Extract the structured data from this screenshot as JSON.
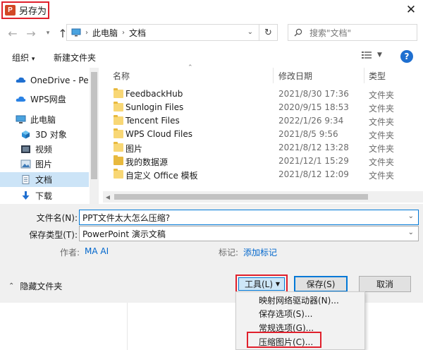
{
  "window": {
    "title": "另存为",
    "app_icon_letter": "P"
  },
  "address": {
    "crumbs": [
      "此电脑",
      "文档"
    ]
  },
  "search": {
    "placeholder": "搜索\"文档\""
  },
  "toolbar": {
    "organize": "组织",
    "new_folder": "新建文件夹",
    "help": "?"
  },
  "nav": {
    "items": [
      {
        "label": "OneDrive - Perso",
        "icon": "cloud-icon"
      },
      {
        "label": "WPS网盘",
        "icon": "cloud-icon"
      },
      {
        "label": "此电脑",
        "icon": "computer-icon"
      },
      {
        "label": "3D 对象",
        "icon": "cube-icon"
      },
      {
        "label": "视频",
        "icon": "video-icon"
      },
      {
        "label": "图片",
        "icon": "picture-icon"
      },
      {
        "label": "文档",
        "icon": "document-icon",
        "selected": true
      },
      {
        "label": "下载",
        "icon": "download-icon"
      }
    ]
  },
  "columns": {
    "name": "名称",
    "date": "修改日期",
    "type": "类型"
  },
  "files": [
    {
      "name": "FeedbackHub",
      "date": "2021/8/30 17:36",
      "type": "文件夹"
    },
    {
      "name": "Sunlogin Files",
      "date": "2020/9/15 18:53",
      "type": "文件夹"
    },
    {
      "name": "Tencent Files",
      "date": "2022/1/26 9:34",
      "type": "文件夹"
    },
    {
      "name": "WPS Cloud Files",
      "date": "2021/8/5 9:56",
      "type": "文件夹"
    },
    {
      "name": "图片",
      "date": "2021/8/12 13:28",
      "type": "文件夹"
    },
    {
      "name": "我的数据源",
      "date": "2021/12/1 15:29",
      "type": "文件夹"
    },
    {
      "name": "自定义 Office 模板",
      "date": "2021/8/12 12:09",
      "type": "文件夹"
    }
  ],
  "form": {
    "filename_label": "文件名(N):",
    "filename_value": "PPT文件太大怎么压缩?",
    "filetype_label": "保存类型(T):",
    "filetype_value": "PowerPoint 演示文稿",
    "author_label": "作者:",
    "author_value": "MA AI",
    "tags_label": "标记:",
    "tags_value": "添加标记"
  },
  "footer": {
    "hide_folders": "隐藏文件夹",
    "tools": "工具(L)",
    "save": "保存(S)",
    "cancel": "取消"
  },
  "tools_menu": {
    "items": [
      "映射网络驱动器(N)...",
      "保存选项(S)...",
      "常规选项(G)...",
      "压缩图片(C)..."
    ]
  },
  "colors": {
    "accent": "#0078d7",
    "highlight_box": "#e0202c",
    "selection": "#cce4f7",
    "link": "#0066cc"
  }
}
